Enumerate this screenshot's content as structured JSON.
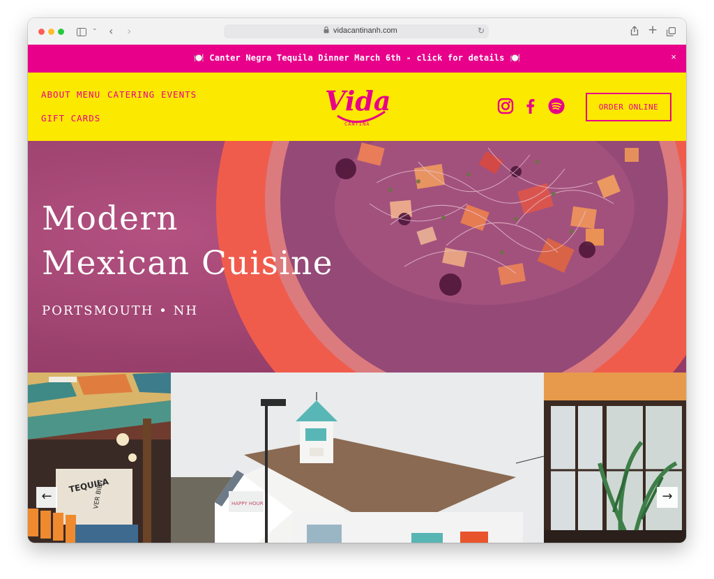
{
  "browser": {
    "url": "vidacantinanh.com",
    "icons": [
      "sidebar-icon",
      "chevron-down-icon",
      "back-arrow-icon",
      "forward-arrow-icon",
      "lock-icon",
      "reload-icon",
      "share-icon",
      "new-tab-plus-icon",
      "tabs-overview-icon"
    ]
  },
  "announcement": {
    "text": "🍽️ Canter Negra Tequila Dinner March 6th - click for details 🍽️",
    "close": "×"
  },
  "nav": {
    "about": "ABOUT",
    "menu": "MENU",
    "catering": "CATERING",
    "events": "EVENTS",
    "gift_cards": "GIFT CARDS"
  },
  "logo": {
    "word": "Vida",
    "sub": "CANTINA"
  },
  "social": [
    "instagram-icon",
    "facebook-icon",
    "spotify-icon"
  ],
  "order_button": "ORDER ONLINE",
  "hero": {
    "title_line1": "Modern",
    "title_line2": "Mexican Cuisine",
    "subtitle": "PORTSMOUTH • NH"
  },
  "gallery": {
    "prev": "←",
    "next": "→",
    "slides": [
      "restaurant interior with colorful ceiling",
      "white cantina building with cupola",
      "dining room with large windows and plants"
    ]
  },
  "colors": {
    "brand_pink": "#e8008a",
    "brand_yellow": "#fbe900",
    "hero_tint": "#a4476f",
    "plate_orange": "#f4553b"
  }
}
